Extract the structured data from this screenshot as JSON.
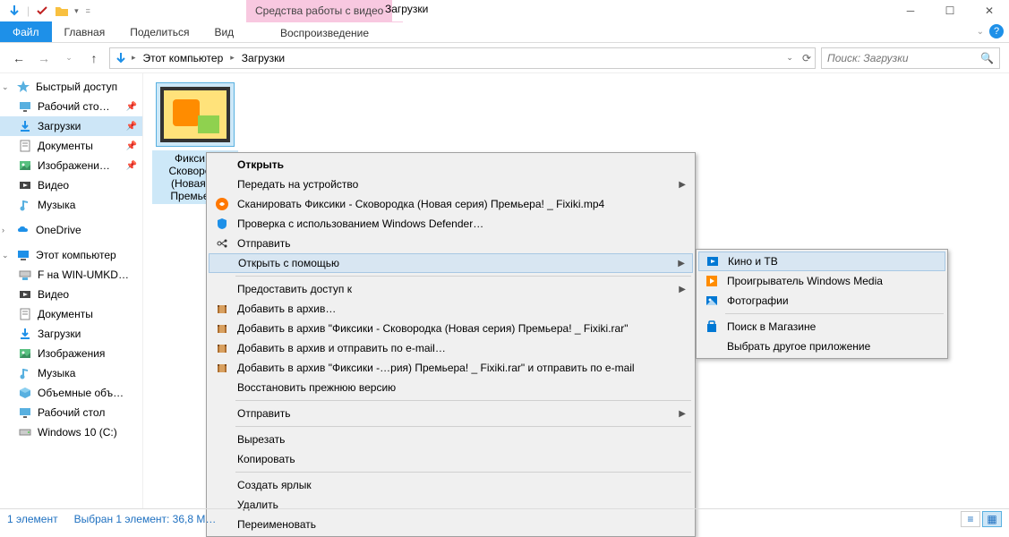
{
  "titlebar": {
    "contextual_tab": "Средства работы с видео",
    "window_title": "Загрузки"
  },
  "ribbon": {
    "file": "Файл",
    "tabs": [
      "Главная",
      "Поделиться",
      "Вид"
    ],
    "context_subtab": "Воспроизведение"
  },
  "address": {
    "segments": [
      "Этот компьютер",
      "Загрузки"
    ],
    "search_placeholder": "Поиск: Загрузки"
  },
  "nav": {
    "quick": {
      "label": "Быстрый доступ",
      "items": [
        {
          "label": "Рабочий сто…",
          "pin": true,
          "icon": "desktop"
        },
        {
          "label": "Загрузки",
          "pin": true,
          "icon": "downloads",
          "selected": true
        },
        {
          "label": "Документы",
          "pin": true,
          "icon": "documents"
        },
        {
          "label": "Изображени…",
          "pin": true,
          "icon": "pictures"
        },
        {
          "label": "Видео",
          "pin": false,
          "icon": "videos"
        },
        {
          "label": "Музыка",
          "pin": false,
          "icon": "music"
        }
      ]
    },
    "onedrive": "OneDrive",
    "thispc": {
      "label": "Этот компьютер",
      "items": [
        {
          "label": "F на WIN-UMKD…",
          "icon": "netdrive"
        },
        {
          "label": "Видео",
          "icon": "videos"
        },
        {
          "label": "Документы",
          "icon": "documents"
        },
        {
          "label": "Загрузки",
          "icon": "downloads"
        },
        {
          "label": "Изображения",
          "icon": "pictures"
        },
        {
          "label": "Музыка",
          "icon": "music"
        },
        {
          "label": "Объемные объ…",
          "icon": "objects3d"
        },
        {
          "label": "Рабочий стол",
          "icon": "desktop"
        },
        {
          "label": "Windows 10 (C:)",
          "icon": "drive"
        }
      ]
    }
  },
  "file_item": {
    "name_lines": "Фикси…\nСковоро…\n(Новая …\nПремье…"
  },
  "context_menu": [
    {
      "label": "Открыть",
      "bold": true
    },
    {
      "label": "Передать на устройство",
      "arrow": true
    },
    {
      "label": "Сканировать Фиксики - Сковородка (Новая серия) Премьера! _ Fixiki.mp4",
      "icon": "avast"
    },
    {
      "label": "Проверка с использованием Windows Defender…",
      "icon": "defender"
    },
    {
      "label": "Отправить",
      "icon": "share"
    },
    {
      "label": "Открыть с помощью",
      "arrow": true,
      "hover": true
    },
    {
      "sep": true
    },
    {
      "label": "Предоставить доступ к",
      "arrow": true
    },
    {
      "label": "Добавить в архив…",
      "icon": "winrar"
    },
    {
      "label": "Добавить в архив \"Фиксики - Сковородка (Новая серия) Премьера! _ Fixiki.rar\"",
      "icon": "winrar"
    },
    {
      "label": "Добавить в архив и отправить по e-mail…",
      "icon": "winrar"
    },
    {
      "label": "Добавить в архив \"Фиксики -…рия) Премьера! _ Fixiki.rar\" и отправить по e-mail",
      "icon": "winrar"
    },
    {
      "label": "Восстановить прежнюю версию"
    },
    {
      "sep": true
    },
    {
      "label": "Отправить",
      "arrow": true
    },
    {
      "sep": true
    },
    {
      "label": "Вырезать"
    },
    {
      "label": "Копировать"
    },
    {
      "sep": true
    },
    {
      "label": "Создать ярлык"
    },
    {
      "label": "Удалить"
    },
    {
      "label": "Переименовать"
    }
  ],
  "submenu": [
    {
      "label": "Кино и ТВ",
      "icon": "movies",
      "hover": true
    },
    {
      "label": "Проигрыватель Windows Media",
      "icon": "wmp"
    },
    {
      "label": "Фотографии",
      "icon": "photos"
    },
    {
      "sep": true
    },
    {
      "label": "Поиск в Магазине",
      "icon": "store"
    },
    {
      "label": "Выбрать другое приложение"
    }
  ],
  "status": {
    "count": "1 элемент",
    "selection": "Выбран 1 элемент: 36,8 М…"
  }
}
